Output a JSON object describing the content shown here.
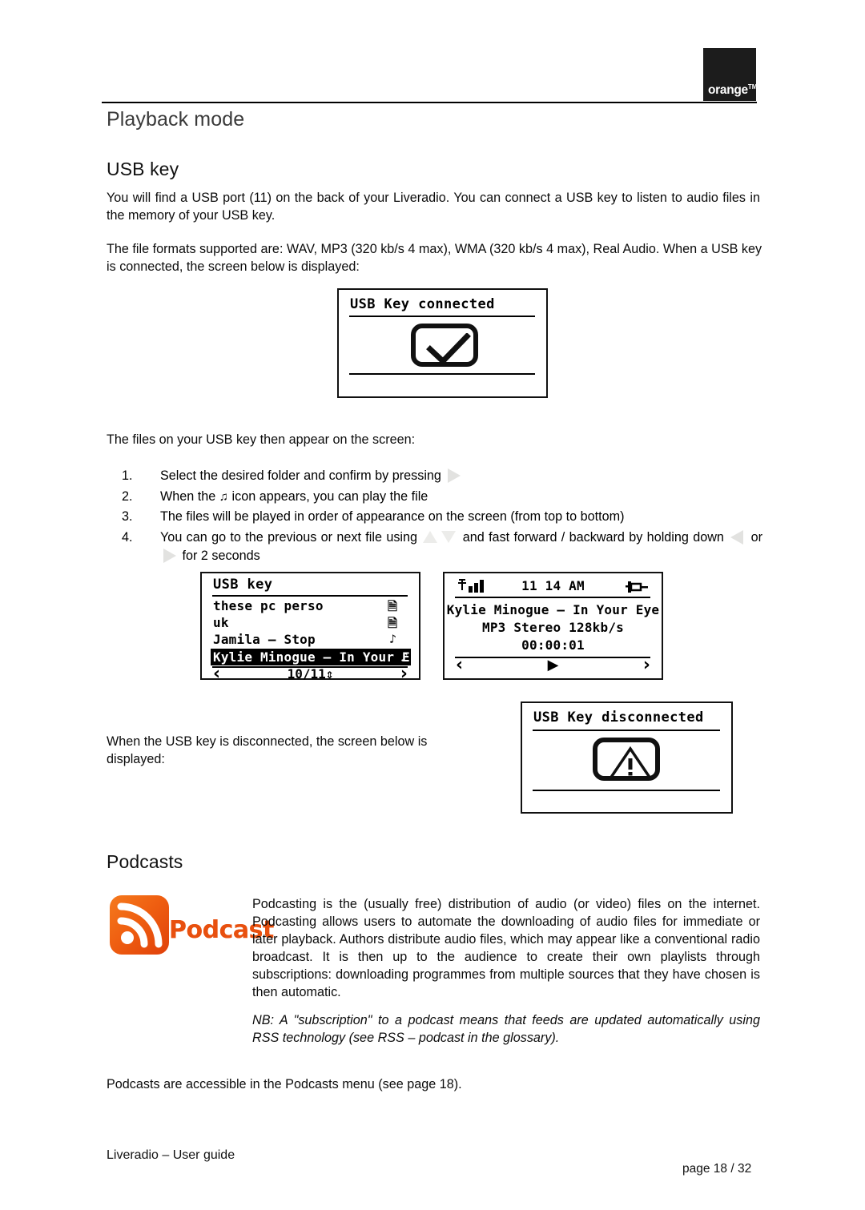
{
  "brand": {
    "logo_text": "orange",
    "logo_tm": "TM"
  },
  "page_title": "Playback mode",
  "sections": {
    "usb": {
      "heading": "USB key",
      "p1": "You will find a USB port (11) on the back of your Liveradio. You can connect a USB key to listen to audio files in the memory of your USB key.",
      "p2": "The file formats supported are: WAV, MP3 (320 kb/s 4 max), WMA (320 kb/s 4 max), Real Audio. When a USB key is connected, the screen below is displayed:",
      "p3": "The files on your USB key then appear on the screen:",
      "p4": "When the USB key is disconnected, the screen below is displayed:",
      "steps": [
        {
          "num": "1.",
          "text_before": "Select the desired folder and confirm by pressing",
          "icon": "right-arrow-key",
          "text_after": ""
        },
        {
          "num": "2.",
          "text_before": "When the",
          "icon": "music-note",
          "text_after": "icon appears, you can play the file"
        },
        {
          "num": "3.",
          "text_before": "The files will be played in order of appearance on the screen (from top to bottom)",
          "icon": "",
          "text_after": ""
        },
        {
          "num": "4.",
          "text_before": "You can go to the previous or next file using",
          "icon": "up-down-arrow-keys",
          "text_after": "and fast forward / backward by holding down",
          "icon2": "left-right-arrow-keys",
          "text_after2": "for 2 seconds",
          "or_word": "or"
        }
      ]
    },
    "podcasts": {
      "heading": "Podcasts",
      "logo_word": "Podcast",
      "p1": "Podcasting is the (usually free) distribution of audio (or video) files on the internet. Podcasting allows users to automate the downloading of audio files for immediate or later playback. Authors distribute audio files, which may appear like a conventional radio broadcast. It is then up to the audience to create their own playlists through subscriptions: downloading programmes from multiple sources that they have chosen is then automatic.",
      "nb": "NB: A \"subscription\" to a podcast means that feeds are updated automatically using RSS technology (see RSS – podcast in the glossary).",
      "p2": "Podcasts are accessible in the Podcasts menu (see page 18)."
    }
  },
  "screens": {
    "connected": {
      "title": "USB Key connected",
      "symbol": "check-mark"
    },
    "disconnected": {
      "title": "USB Key disconnected",
      "symbol": "warning-triangle"
    },
    "browser": {
      "title": "USB key",
      "rows": [
        {
          "label": "these pc perso",
          "icon": "file-icon",
          "selected": false
        },
        {
          "label": "uk",
          "icon": "file-icon",
          "selected": false
        },
        {
          "label": "Jamila – Stop",
          "icon": "music-note-icon",
          "selected": false
        },
        {
          "label": "Kylie Minogue – In Your E",
          "icon": "music-note-icon",
          "selected": true
        }
      ],
      "nav_left": "‹",
      "nav_center": "10/11",
      "nav_updown": "⇕",
      "nav_right": "›"
    },
    "player": {
      "status_signal": "signal-bars",
      "status_time": "11 14 AM",
      "status_power": "power-plug",
      "line1": "Kylie Minogue – In Your Eye",
      "line2": "MP3 Stereo 128kb/s",
      "line3": "00:00:01",
      "nav_left": "‹",
      "nav_play": "▶",
      "nav_right": "›"
    }
  },
  "footer": {
    "left": "Liveradio – User guide",
    "right": "page 18 / 32"
  }
}
